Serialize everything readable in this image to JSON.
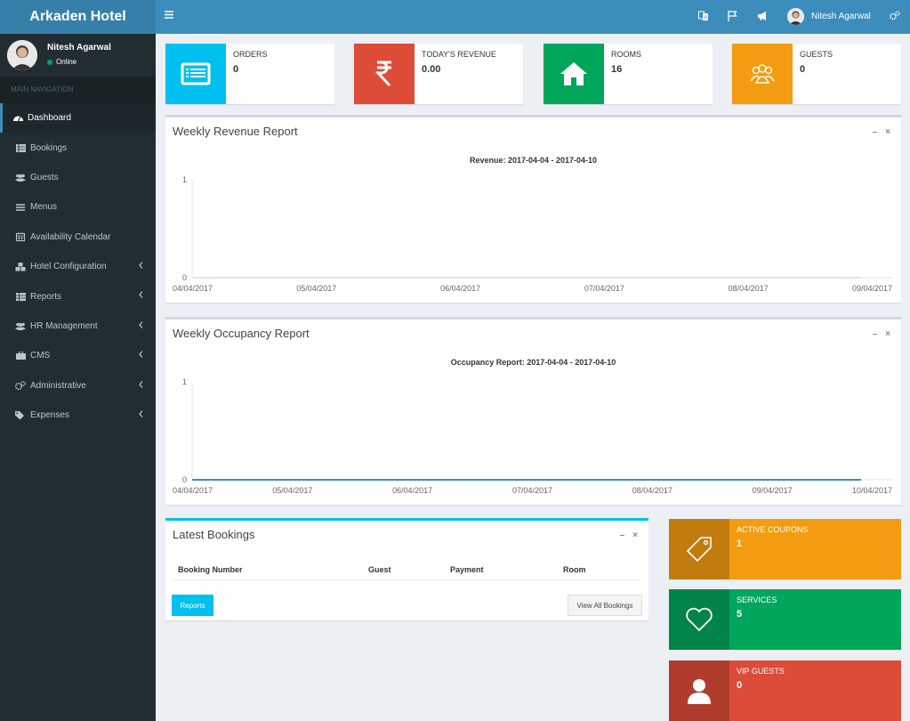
{
  "app": {
    "title": "Arkaden Hotel"
  },
  "user": {
    "name": "Nitesh Agarwal",
    "status": "Online"
  },
  "sidebar": {
    "header": "MAIN NAVIGATION",
    "items": [
      {
        "label": "Dashboard",
        "icon": "dashboard-icon"
      },
      {
        "label": "Bookings",
        "icon": "list-icon"
      },
      {
        "label": "Guests",
        "icon": "users-icon"
      },
      {
        "label": "Menus",
        "icon": "bars-icon"
      },
      {
        "label": "Availability Calendar",
        "icon": "calendar-icon"
      },
      {
        "label": "Hotel Configuration",
        "icon": "cubes-icon"
      },
      {
        "label": "Reports",
        "icon": "table-icon"
      },
      {
        "label": "HR Management",
        "icon": "users-icon"
      },
      {
        "label": "CMS",
        "icon": "briefcase-icon"
      },
      {
        "label": "Administrative",
        "icon": "cogs-icon"
      },
      {
        "label": "Expenses",
        "icon": "tags-icon"
      }
    ]
  },
  "topbar": {
    "user_name": "Nitesh Agarwal"
  },
  "infoboxes": [
    {
      "label": "ORDERS",
      "value": "0",
      "color": "#00c0ef"
    },
    {
      "label": "TODAY'S REVENUE",
      "value": "0.00",
      "color": "#dd4b39"
    },
    {
      "label": "ROOMS",
      "value": "16",
      "color": "#00a65a"
    },
    {
      "label": "GUESTS",
      "value": "0",
      "color": "#f39c12"
    }
  ],
  "revenue_box": {
    "title": "Weekly Revenue Report"
  },
  "occupancy_box": {
    "title": "Weekly Occupancy Report"
  },
  "chart_data": [
    {
      "type": "line",
      "title": "Revenue: 2017-04-04 - 2017-04-10",
      "x": [
        "04/04/2017",
        "05/04/2017",
        "06/04/2017",
        "07/04/2017",
        "08/04/2017",
        "09/04/2017"
      ],
      "series": [
        {
          "values": [
            0,
            0,
            0,
            0,
            0,
            0
          ]
        }
      ],
      "ylim": [
        0,
        1
      ],
      "yticks": [
        "0",
        "1"
      ],
      "grid": false
    },
    {
      "type": "line",
      "title": "Occupancy Report: 2017-04-04 - 2017-04-10",
      "x": [
        "04/04/2017",
        "05/04/2017",
        "06/04/2017",
        "07/04/2017",
        "08/04/2017",
        "09/04/2017",
        "10/04/2017"
      ],
      "series": [
        {
          "values": [
            0,
            0,
            0,
            0,
            0,
            0,
            0
          ],
          "color": "#3c8dbc"
        }
      ],
      "ylim": [
        0,
        1
      ],
      "yticks": [
        "0",
        "1"
      ],
      "grid": false
    }
  ],
  "bookings": {
    "title": "Latest Bookings",
    "columns": [
      "Booking Number",
      "Guest",
      "Payment",
      "Room"
    ],
    "reports_label": "Reports",
    "view_all_label": "View All Bookings"
  },
  "side_stats": [
    {
      "label": "ACTIVE COUPONS",
      "value": "1",
      "color": "#f39c12",
      "icon": "tag-icon"
    },
    {
      "label": "SERVICES",
      "value": "5",
      "color": "#00a65a",
      "icon": "heart-icon"
    },
    {
      "label": "VIP GUESTS",
      "value": "0",
      "color": "#dd4b39",
      "icon": "user-icon"
    }
  ]
}
